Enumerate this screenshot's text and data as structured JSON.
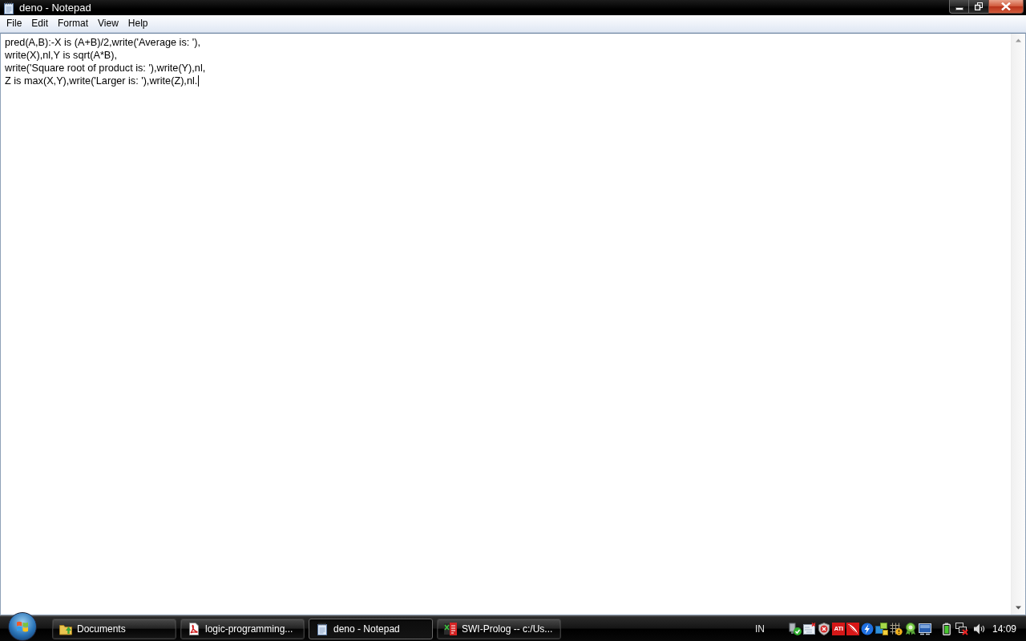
{
  "window": {
    "title": "deno - Notepad"
  },
  "menu": [
    {
      "label": "File"
    },
    {
      "label": "Edit"
    },
    {
      "label": "Format"
    },
    {
      "label": "View"
    },
    {
      "label": "Help"
    }
  ],
  "editor": {
    "lines": [
      "pred(A,B):-X is (A+B)/2,write('Average is: '),",
      "write(X),nl,Y is sqrt(A*B),",
      "write('Square root of product is: '),write(Y),nl,",
      "Z is max(X,Y),write('Larger is: '),write(Z),nl."
    ],
    "caret": true
  },
  "taskbar": {
    "buttons": [
      {
        "label": "Documents",
        "kind": "folder",
        "selected": false
      },
      {
        "label": "logic-programming...",
        "kind": "pdf",
        "selected": false
      },
      {
        "label": "deno - Notepad",
        "kind": "notepad",
        "selected": true
      },
      {
        "label": "SWI-Prolog -- c:/Us...",
        "kind": "prolog",
        "selected": false
      }
    ],
    "language": "IN",
    "tray_logo": "ATI",
    "clock": "14:09"
  }
}
